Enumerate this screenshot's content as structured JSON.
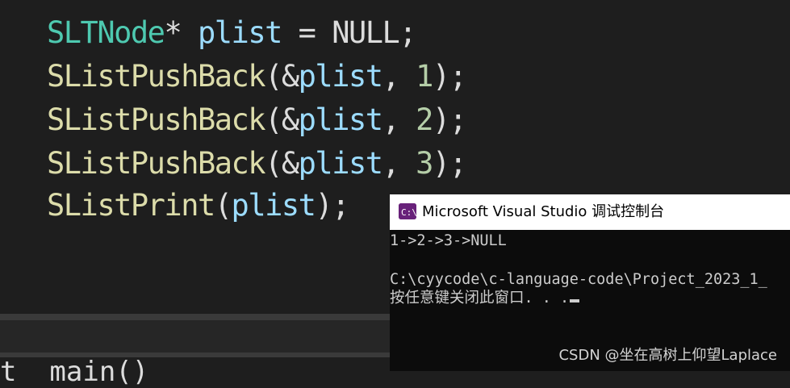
{
  "editor": {
    "line1": {
      "type_name": "SLTNode",
      "star": "*",
      "var_name": "plist",
      "op": " = ",
      "macro": "NULL",
      "semi": ";"
    },
    "line2": {
      "fn": "SListPushBack",
      "open": "(",
      "amp": "&",
      "var": "plist",
      "comma": ", ",
      "num": "1",
      "close": ");"
    },
    "line3": {
      "fn": "SListPushBack",
      "open": "(",
      "amp": "&",
      "var": "plist",
      "comma": ", ",
      "num": "2",
      "close": ");"
    },
    "line4": {
      "fn": "SListPushBack",
      "open": "(",
      "amp": "&",
      "var": "plist",
      "comma": ", ",
      "num": "3",
      "close": ");"
    },
    "line5": {
      "fn": "SListPrint",
      "open": "(",
      "var": "plist",
      "close": ");"
    },
    "partial_line": "t  main()"
  },
  "console": {
    "title": "Microsoft Visual Studio 调试控制台",
    "icon": "visual-studio-icon",
    "output_line": "1->2->3->NULL",
    "path_line": "C:\\cyycode\\c-language-code\\Project_2023_1_",
    "prompt_line": "按任意键关闭此窗口. . ."
  },
  "watermark": "CSDN @坐在高树上仰望Laplace",
  "colors": {
    "editor_bg": "#1e1e1e",
    "type": "#4ec9b0",
    "variable": "#9cdcfe",
    "function": "#dcdcaa",
    "number": "#b5cea8",
    "console_bg": "#0c0c0c",
    "console_text": "#cccccc"
  }
}
